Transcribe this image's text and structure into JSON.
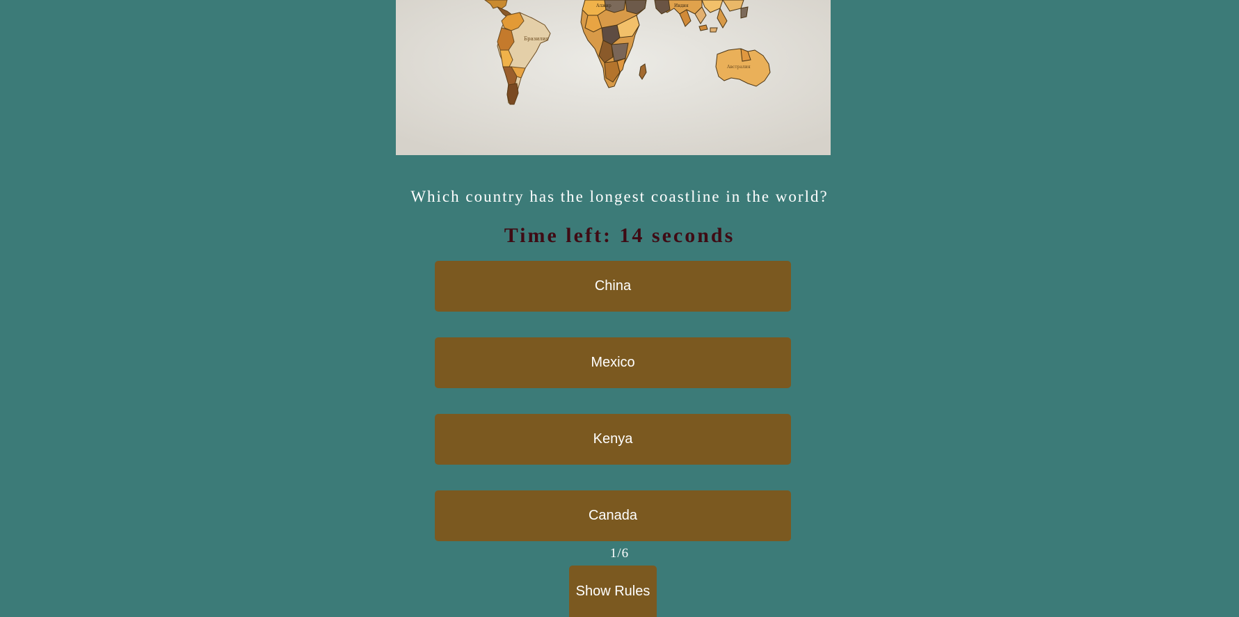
{
  "hero": {
    "image": "world-map-puzzle-photo",
    "labels": {
      "south_america": "Бразилия",
      "australia": "Австралия",
      "africa_north": "Алжир",
      "asia": "Индия"
    }
  },
  "quiz": {
    "question": "Which country has the longest coastline in the world?",
    "timer_text": "Time left: 14 seconds",
    "answers": [
      {
        "label": "China"
      },
      {
        "label": "Mexico"
      },
      {
        "label": "Kenya"
      },
      {
        "label": "Canada"
      }
    ],
    "progress": "1/6",
    "rules_label": "Show Rules"
  },
  "colors": {
    "background": "#3c7b78",
    "button": "#7b5920",
    "timer": "#3f0b14",
    "text": "#ffffff"
  }
}
